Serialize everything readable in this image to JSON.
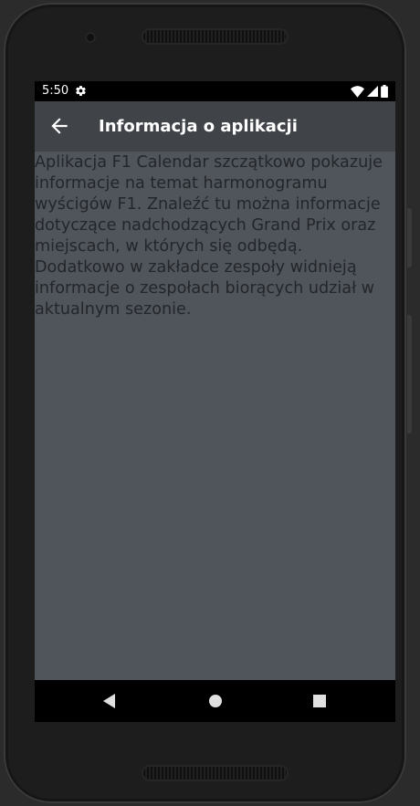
{
  "status_bar": {
    "time": "5:50",
    "icons": [
      "gear-icon",
      "wifi-icon",
      "signal-icon",
      "battery-icon"
    ]
  },
  "app_bar": {
    "title": "Informacja o aplikacji",
    "back_icon": "arrow-back-icon"
  },
  "content": {
    "description": "Aplikacja F1 Calendar szczątkowo pokazuje informacje na temat harmonogramu wyścigów F1. Znaleźć tu można informacje dotyczące nadchodzących Grand Prix oraz miejscach, w których się odbędą. Dodatkowo w zakładce zespoły widnieją informacje o zespołach biorących udział w aktualnym sezonie."
  },
  "nav_bar": {
    "buttons": [
      "back-triangle-icon",
      "home-circle-icon",
      "recents-square-icon"
    ]
  },
  "colors": {
    "screen_bg": "#50555b",
    "app_bar_bg": "#404348",
    "text": "#23262a",
    "bezel": "#1d1d1d"
  }
}
